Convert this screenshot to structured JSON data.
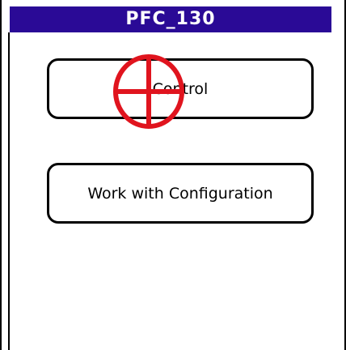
{
  "window": {
    "title": "PFC_130"
  },
  "buttons": {
    "control_label": "Control",
    "config_label": "Work with Configuration"
  },
  "colors": {
    "title_bar": "#2a0a96",
    "cursor": "#e0141e"
  },
  "icons": {
    "cursor": "crosshair-target-icon"
  }
}
